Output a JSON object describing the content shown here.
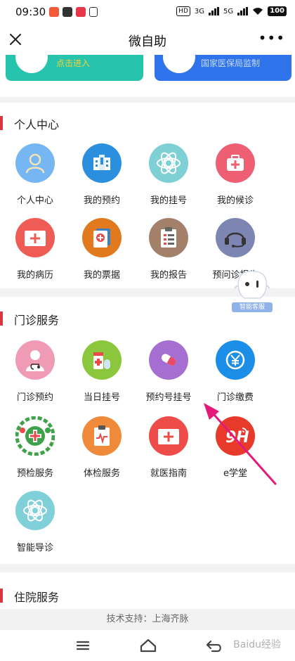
{
  "status_bar": {
    "time": "09:30",
    "hd_label": "HD",
    "signal1": "3G",
    "signal2": "5G",
    "battery": "100"
  },
  "header": {
    "title": "微自助"
  },
  "banners": [
    {
      "text": "点击进入",
      "color": "#27c4ad"
    },
    {
      "text": "国家医保局监制",
      "color": "#2f74ea"
    }
  ],
  "sections": {
    "personal": {
      "title": "个人中心",
      "items": [
        {
          "label": "个人中心",
          "icon": "user-icon",
          "color": "#76b6f2"
        },
        {
          "label": "我的预约",
          "icon": "hospital-building-icon",
          "color": "#2b8fe0"
        },
        {
          "label": "我的挂号",
          "icon": "ticket-emblem-icon",
          "color": "#7ed0d6"
        },
        {
          "label": "我的候诊",
          "icon": "medical-kit-icon",
          "color": "#ee5f73"
        },
        {
          "label": "我的病历",
          "icon": "medical-record-icon",
          "color": "#ef5b55"
        },
        {
          "label": "我的票据",
          "icon": "receipt-icon",
          "color": "#e1791e"
        },
        {
          "label": "我的报告",
          "icon": "report-clipboard-icon",
          "color": "#a3806a"
        },
        {
          "label": "预问诊报告",
          "icon": "headset-icon",
          "color": "#7d86b3"
        }
      ]
    },
    "outpatient": {
      "title": "门诊服务",
      "items": [
        {
          "label": "门诊预约",
          "icon": "doctor-icon",
          "color": "#f09bb5"
        },
        {
          "label": "当日挂号",
          "icon": "medicine-bottle-icon",
          "color": "#8ac73c"
        },
        {
          "label": "预约号挂号",
          "icon": "capsule-pill-icon",
          "color": "#a56fd2"
        },
        {
          "label": "门诊缴费",
          "icon": "yen-payment-icon",
          "color": "#1b8fe8"
        },
        {
          "label": "预检服务",
          "icon": "health-cross-emblem-icon",
          "color": "#3fa24a"
        },
        {
          "label": "体检服务",
          "icon": "checkup-clipboard-icon",
          "color": "#f08a3b"
        },
        {
          "label": "就医指南",
          "icon": "first-aid-guide-icon",
          "color": "#ef4b48"
        },
        {
          "label": "e学堂",
          "icon": "e-school-icon",
          "color": "#e73a2b"
        },
        {
          "label": "智能导诊",
          "icon": "smart-guide-icon",
          "color": "#7fd0d8"
        }
      ]
    },
    "inpatient": {
      "title": "住院服务"
    }
  },
  "robot": {
    "label": "智能客服"
  },
  "footer": {
    "credit": "技术支持：上海齐脉"
  },
  "watermark": "Baidu经验"
}
